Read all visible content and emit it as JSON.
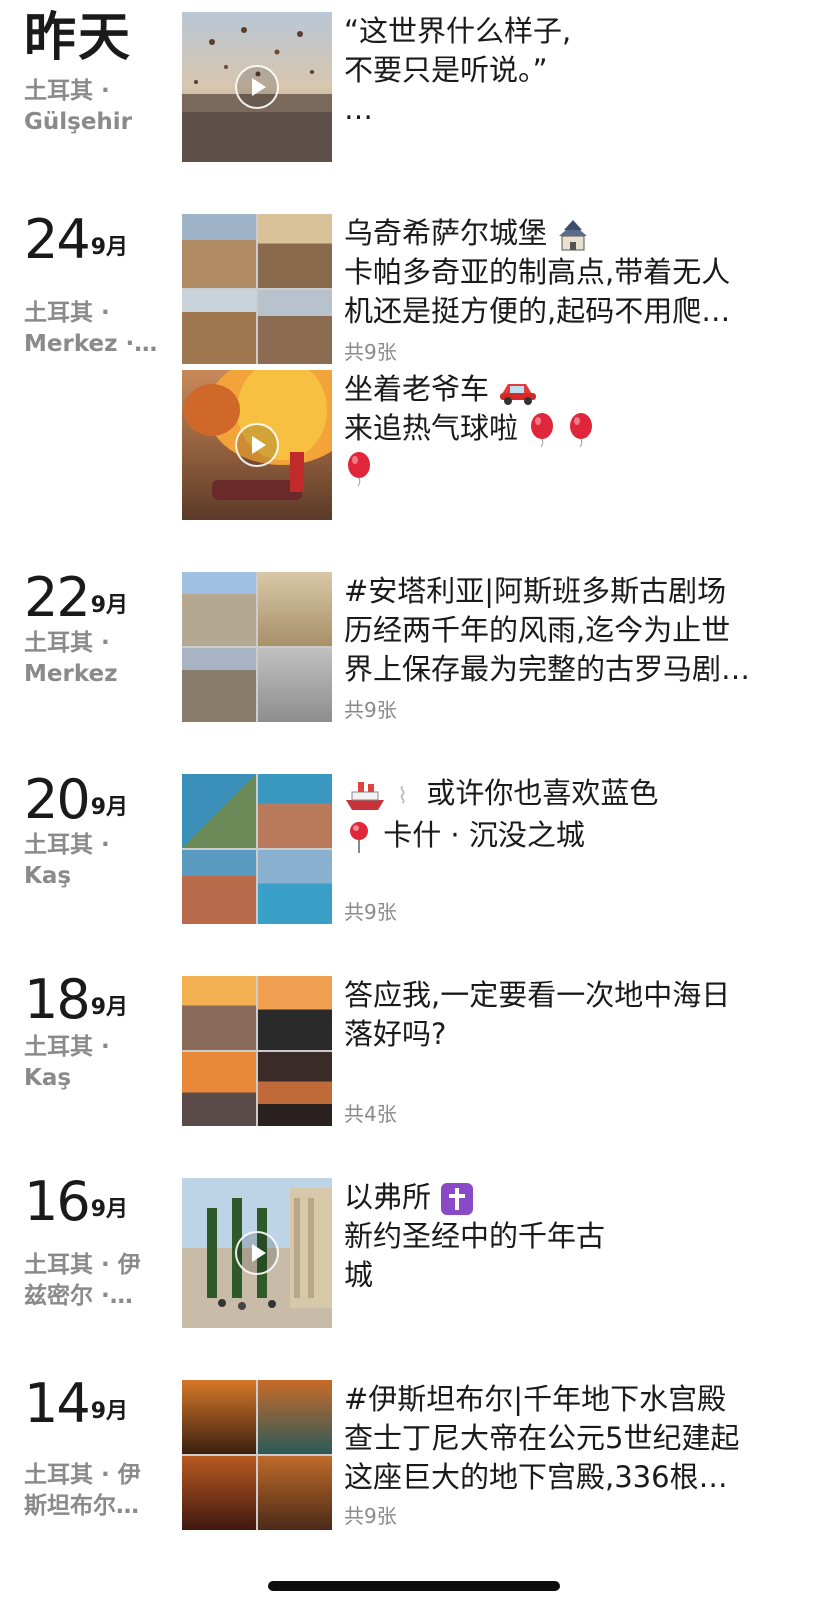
{
  "entries": [
    {
      "date_main": "昨天",
      "location": [
        "土耳其 ·",
        "Gülşehir"
      ],
      "text_lines": [
        "“这世界什么样子,",
        "不要只是听说。”",
        "…"
      ],
      "count": "",
      "has_video": true
    },
    {
      "date_day": "24",
      "date_month": "9月",
      "location": [
        "土耳其 ·",
        "Merkez ·…"
      ],
      "text_lines": [
        "乌奇希萨尔城堡",
        "卡帕多奇亚的制高点,带着无人",
        "机还是挺方便的,起码不用爬…"
      ],
      "count": "共9张",
      "has_video": false
    },
    {
      "text_lines": [
        "坐着老爷车",
        "来追热气球啦",
        ""
      ],
      "count": "",
      "has_video": true
    },
    {
      "date_day": "22",
      "date_month": "9月",
      "location": [
        "土耳其 ·",
        "Merkez"
      ],
      "text_lines": [
        "#安塔利亚|阿斯班多斯古剧场",
        "历经两千年的风雨,迄今为止世",
        "界上保存最为完整的古罗马剧…"
      ],
      "count": "共9张",
      "has_video": false
    },
    {
      "date_day": "20",
      "date_month": "9月",
      "location": [
        "土耳其 ·",
        "Kaş"
      ],
      "text_lines": [
        "或许你也喜欢蓝色",
        "",
        "卡什 · 沉没之城"
      ],
      "count": "共9张",
      "has_video": false
    },
    {
      "date_day": "18",
      "date_month": "9月",
      "location": [
        "土耳其 ·",
        "Kaş"
      ],
      "text_lines": [
        "答应我,一定要看一次地中海日",
        "落好吗?"
      ],
      "count": "共4张",
      "has_video": false
    },
    {
      "date_day": "16",
      "date_month": "9月",
      "location": [
        "土耳其 · 伊",
        "兹密尔 ·…"
      ],
      "text_lines": [
        "以弗所",
        "新约圣经中的千年古",
        "城"
      ],
      "count": "",
      "has_video": true
    },
    {
      "date_day": "14",
      "date_month": "9月",
      "location": [
        "土耳其 · 伊",
        "斯坦布尔…"
      ],
      "text_lines": [
        "#伊斯坦布尔|千年地下水宫殿",
        "查士丁尼大帝在公元5世纪建起",
        "这座巨大的地下宫殿,336根…"
      ],
      "count": "共9张",
      "has_video": false
    }
  ],
  "icons": [
    "castle-emoji-icon",
    "red-car-emoji-icon",
    "balloon-emoji-icon",
    "ship-emoji-icon",
    "round-pushpin-icon",
    "latin-cross-icon",
    "play-icon"
  ]
}
